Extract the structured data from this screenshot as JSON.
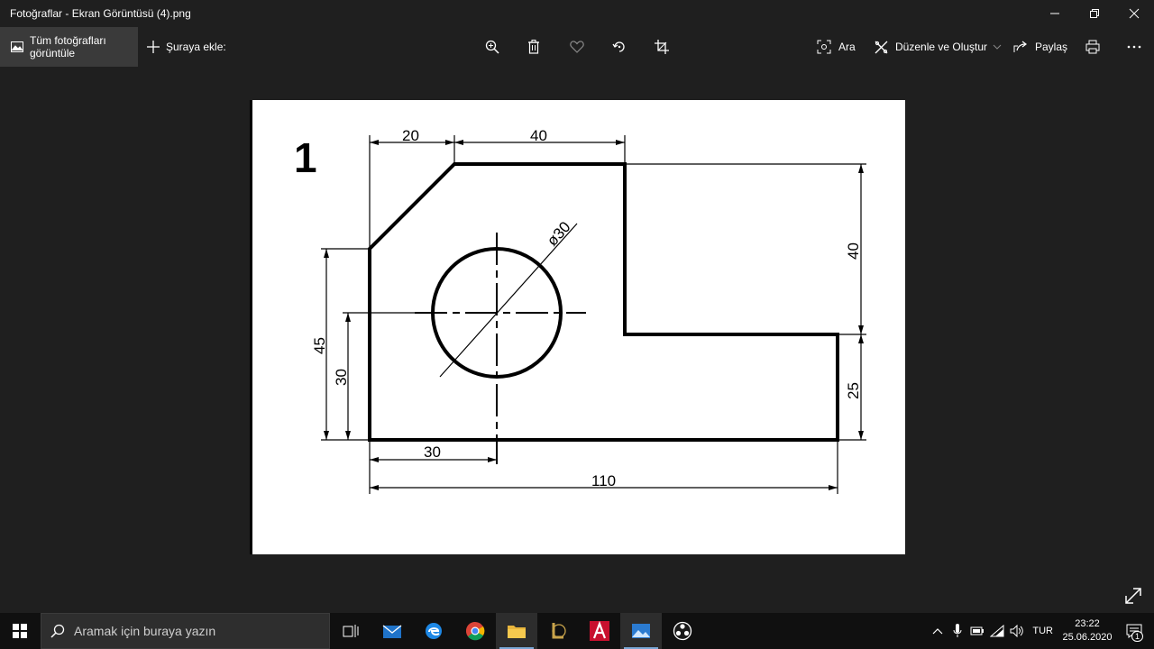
{
  "window": {
    "title": "Fotoğraflar - Ekran Görüntüsü (4).png"
  },
  "toolbar": {
    "all_photos_label": "Tüm fotoğrafları görüntüle",
    "add_to_label": "Şuraya ekle:",
    "search_label": "Ara",
    "edit_create_label": "Düzenle ve Oluştur",
    "share_label": "Paylaş"
  },
  "drawing": {
    "sheet_number": "1",
    "dim_top_left": "20",
    "dim_top_right": "40",
    "dim_diameter": "ø30",
    "dim_right_upper": "40",
    "dim_right_lower": "25",
    "dim_left_outer": "45",
    "dim_left_inner": "30",
    "dim_bottom_short": "30",
    "dim_bottom_long": "110"
  },
  "taskbar": {
    "search_placeholder": "Aramak için buraya yazın",
    "language": "TUR",
    "time": "23:22",
    "date": "25.06.2020",
    "notification_count": "1"
  },
  "colors": {
    "background": "#1f1f1f",
    "taskbar": "#101010",
    "accent": "#7aa7d6"
  }
}
